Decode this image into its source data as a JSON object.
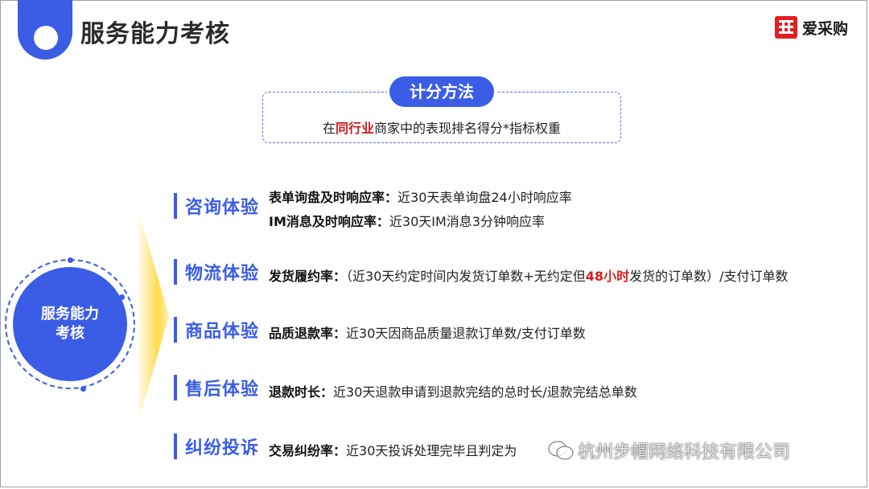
{
  "header": {
    "title": "服务能力考核",
    "logo_text": "爱采购"
  },
  "method": {
    "label": "计分方法",
    "text_pre": "在",
    "text_highlight": "同行业",
    "text_post": "商家中的表现排名得分*指标权重"
  },
  "circle": {
    "line1": "服务能力",
    "line2": "考核"
  },
  "categories": [
    {
      "name": "咨询体验",
      "items": [
        {
          "key": "表单询盘及时响应率：",
          "desc": "近30天表单询盘24小时响应率"
        },
        {
          "key": "IM消息及时响应率：",
          "desc": "近30天IM消息3分钟响应率"
        }
      ]
    },
    {
      "name": "物流体验",
      "items": [
        {
          "key": "发货履约率：",
          "desc_pre": "（近30天约定时间内发货订单数+无约定但",
          "desc_red": "48小时",
          "desc_post": "发货的订单数）/支付订单数"
        }
      ]
    },
    {
      "name": "商品体验",
      "items": [
        {
          "key": "品质退款率：",
          "desc": "近30天因商品质量退款订单数/支付订单数"
        }
      ]
    },
    {
      "name": "售后体验",
      "items": [
        {
          "key": "退款时长：",
          "desc": "近30天退款申请到退款完结的总时长/退款完结总单数"
        }
      ]
    },
    {
      "name": "纠纷投诉",
      "items": [
        {
          "key": "交易纠纷率：",
          "desc": "近30天投诉处理完毕且判定为"
        }
      ]
    }
  ],
  "watermark": {
    "text": "杭州步帽网络科技有限公司"
  },
  "colors": {
    "brand_blue": "#3b5de6",
    "highlight_red": "#d91e1e",
    "logo_red": "#e02020"
  }
}
